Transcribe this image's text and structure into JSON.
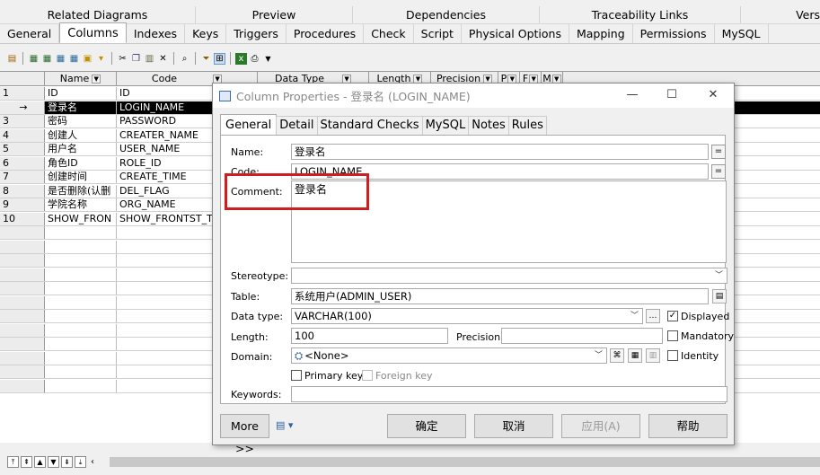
{
  "top_tabs": [
    "Related Diagrams",
    "Preview",
    "Dependencies",
    "Traceability Links",
    "Vers"
  ],
  "sub_tabs": [
    {
      "label": "General",
      "active": false
    },
    {
      "label": "Columns",
      "active": true
    },
    {
      "label": "Indexes",
      "active": false
    },
    {
      "label": "Keys",
      "active": false
    },
    {
      "label": "Triggers",
      "active": false
    },
    {
      "label": "Procedures",
      "active": false
    },
    {
      "label": "Check",
      "active": false
    },
    {
      "label": "Script",
      "active": false
    },
    {
      "label": "Physical Options",
      "active": false
    },
    {
      "label": "Mapping",
      "active": false
    },
    {
      "label": "Permissions",
      "active": false
    },
    {
      "label": "MySQL",
      "active": false
    }
  ],
  "grid": {
    "headers": {
      "name": "Name",
      "code": "Code",
      "data_type": "Data Type",
      "length": "Length",
      "precision": "Precision",
      "p": "P",
      "f": "F",
      "m": "M"
    },
    "rows": [
      {
        "num": "1",
        "name": "ID",
        "code": "ID"
      },
      {
        "num": "→",
        "name": "登录名",
        "code": "LOGIN_NAME",
        "selected": true
      },
      {
        "num": "3",
        "name": "密码",
        "code": "PASSWORD"
      },
      {
        "num": "4",
        "name": "创建人",
        "code": "CREATER_NAME"
      },
      {
        "num": "5",
        "name": "用户名",
        "code": "USER_NAME"
      },
      {
        "num": "6",
        "name": "角色ID",
        "code": "ROLE_ID"
      },
      {
        "num": "7",
        "name": "创建时间",
        "code": "CREATE_TIME"
      },
      {
        "num": "8",
        "name": "是否删除(认删",
        "code": "DEL_FLAG"
      },
      {
        "num": "9",
        "name": "学院名称",
        "code": "ORG_NAME"
      },
      {
        "num": "10",
        "name": "SHOW_FRON",
        "code": "SHOW_FRONTST_T"
      }
    ]
  },
  "dialog": {
    "title": "Column Properties - 登录名 (LOGIN_NAME)",
    "tabs": [
      {
        "label": "General",
        "active": true
      },
      {
        "label": "Detail",
        "active": false
      },
      {
        "label": "Standard Checks",
        "active": false
      },
      {
        "label": "MySQL",
        "active": false
      },
      {
        "label": "Notes",
        "active": false
      },
      {
        "label": "Rules",
        "active": false
      }
    ],
    "name_label": "Name:",
    "name_value": "登录名",
    "code_label": "Code:",
    "code_value": "LOGIN_NAME",
    "comment_label": "Comment:",
    "comment_value": "登录名",
    "stereotype_label": "Stereotype:",
    "stereotype_value": "",
    "table_label": "Table:",
    "table_value": "系统用户(ADMIN_USER)",
    "datatype_label": "Data type:",
    "datatype_value": "VARCHAR(100)",
    "displayed_label": "Displayed",
    "displayed_checked": true,
    "length_label": "Length:",
    "length_value": "100",
    "precision_label": "Precision:",
    "precision_value": "",
    "mandatory_label": "Mandatory",
    "domain_label": "Domain:",
    "domain_value": "<None>",
    "identity_label": "Identity",
    "primary_key_label": "Primary key",
    "foreign_key_label": "Foreign key",
    "keywords_label": "Keywords:",
    "keywords_value": "",
    "more_button": "More >>",
    "ok_button": "确定",
    "cancel_button": "取消",
    "apply_button": "应用(A)",
    "help_button": "帮助"
  },
  "colors": {
    "highlight": "#cc2020",
    "selected_row": "#000000"
  }
}
